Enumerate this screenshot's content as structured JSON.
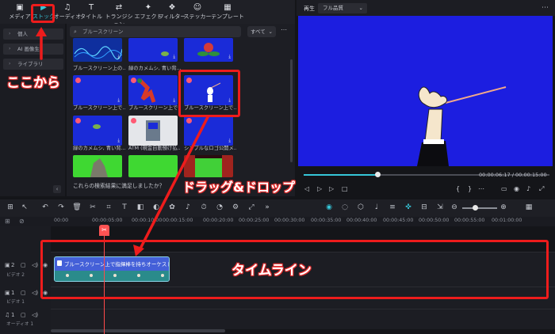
{
  "tabs": [
    {
      "icon": "media-icon",
      "label": "メディア"
    },
    {
      "icon": "stock-icon",
      "label": "ストック"
    },
    {
      "icon": "audio-icon",
      "label": "オーディオ"
    },
    {
      "icon": "title-icon",
      "label": "タイトル"
    },
    {
      "icon": "transition-icon",
      "label": "トランジション"
    },
    {
      "icon": "effect-icon",
      "label": "エフェクト"
    },
    {
      "icon": "filter-icon",
      "label": "フィルター"
    },
    {
      "icon": "sticker-icon",
      "label": "ステッカー"
    },
    {
      "icon": "template-icon",
      "label": "テンプレート"
    }
  ],
  "active_tab": "ストック",
  "left_panel": {
    "items": [
      "個人",
      "AI 画像生",
      "ライブラリ"
    ]
  },
  "search": {
    "placeholder": "ブルースクリーン",
    "filter": "すべて"
  },
  "media_captions": [
    "ブルースクリーン上の...",
    "緑のカメムシ, 青い背...",
    "ブルースクリーン上で...",
    "ブルースクリーン上で...",
    "緑のカメムシ, 青い背...",
    "ATM (現金自動預け払...",
    "シンプルなロゴ公開メ..."
  ],
  "satisfied_prompt": "これらの検索結果に満足しましたか？",
  "preview": {
    "label": "再生",
    "quality": "フル品質",
    "current_time": "00:00:06:17",
    "separator": "/",
    "total_time": "00:00:15:00",
    "progress": 0.3
  },
  "ruler_labels": [
    "00:00",
    "00:00:05:00",
    "00:00:10:00",
    "00:00:15:00",
    "00:00:20:00",
    "00:00:25:00",
    "00:00:30:00",
    "00:00:35:00",
    "00:00:40:00",
    "00:00:45:00",
    "00:00:50:00",
    "00:00:55:00",
    "00:01:00:00"
  ],
  "tracks": [
    {
      "num": "2",
      "label": "ビデオ 2"
    },
    {
      "num": "1",
      "label": "ビデオ 1"
    },
    {
      "num": "1",
      "label": "オーディオ 1"
    }
  ],
  "clip": {
    "title": "ブルースクリーン上で指揮棒を持ちオーケストラを..."
  },
  "annotations": {
    "from_here": "ここから",
    "drag_drop": "ドラッグ&ドロップ",
    "timeline": "タイムライン"
  },
  "colors": {
    "accent": "#36c6d8",
    "annotation_red": "#ee1c1c",
    "blue_screen": "#1c1ee0",
    "playhead": "#ff4a4a"
  }
}
